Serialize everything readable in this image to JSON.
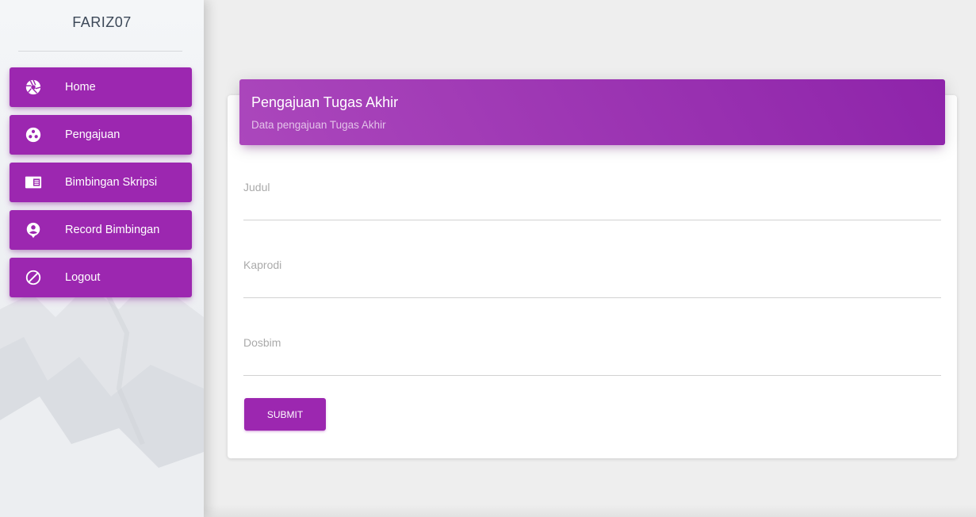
{
  "sidebar": {
    "brand": "FARIZ07",
    "items": [
      {
        "label": "Home",
        "icon": "aperture-icon"
      },
      {
        "label": "Pengajuan",
        "icon": "bubble-chart-icon"
      },
      {
        "label": "Bimbingan Skripsi",
        "icon": "featured-play-list-icon"
      },
      {
        "label": "Record Bimbingan",
        "icon": "account-circle-icon"
      },
      {
        "label": "Logout",
        "icon": "block-icon"
      }
    ]
  },
  "card": {
    "title": "Pengajuan Tugas Akhir",
    "subtitle": "Data pengajuan Tugas Akhir"
  },
  "form": {
    "fields": [
      {
        "label": "Judul",
        "value": ""
      },
      {
        "label": "Kaprodi",
        "value": ""
      },
      {
        "label": "Dosbim",
        "value": ""
      }
    ],
    "submit_label": "SUBMIT"
  },
  "colors": {
    "accent": "#9c27b0",
    "header_gradient_start": "#ab47bc",
    "header_gradient_end": "#8e24aa",
    "background": "#eeeeee"
  }
}
